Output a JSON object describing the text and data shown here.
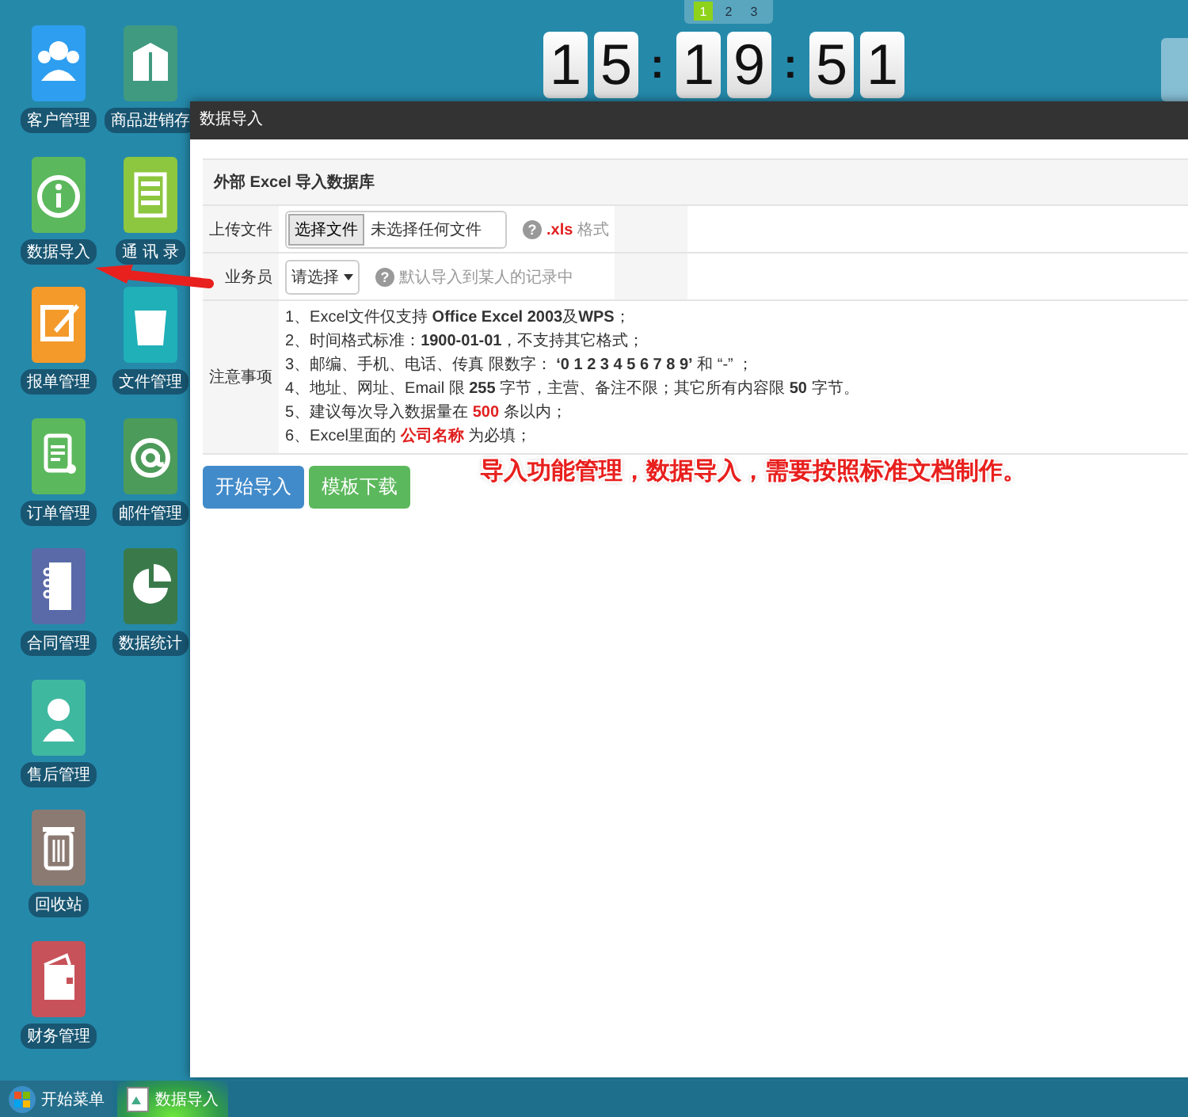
{
  "pager": {
    "pages": [
      {
        "label": "1",
        "selected": true
      },
      {
        "label": "2",
        "selected": false
      },
      {
        "label": "3",
        "selected": false
      }
    ]
  },
  "clock": {
    "parts": [
      {
        "kind": "digit",
        "text": "1"
      },
      {
        "kind": "digit",
        "text": "5"
      },
      {
        "kind": "colon",
        "text": ":"
      },
      {
        "kind": "digit",
        "text": "1"
      },
      {
        "kind": "digit",
        "text": "9"
      },
      {
        "kind": "colon",
        "text": ":"
      },
      {
        "kind": "digit",
        "text": "5"
      },
      {
        "kind": "digit",
        "text": "1"
      }
    ]
  },
  "desktop_icons": {
    "columns": [
      [
        {
          "label": "客户管理",
          "color": "#2e9ef0"
        },
        {
          "label": "数据导入",
          "color": "#5cb85c"
        },
        {
          "label": "报单管理",
          "color": "#f39a2b"
        },
        {
          "label": "订单管理",
          "color": "#5cb85c"
        },
        {
          "label": "合同管理",
          "color": "#5a6aa8"
        },
        {
          "label": "售后管理",
          "color": "#3fb8a0"
        },
        {
          "label": "回收站",
          "color": "#8a7a72"
        },
        {
          "label": "财务管理",
          "color": "#c8525a"
        }
      ],
      [
        {
          "label": "商品进销存",
          "color": "#3f9a80"
        },
        {
          "label": "通 讯 录",
          "color": "#8dc63f"
        },
        {
          "label": "文件管理",
          "color": "#1fb0b8"
        },
        {
          "label": "邮件管理",
          "color": "#4d9b5a"
        },
        {
          "label": "数据统计",
          "color": "#3a7a4a"
        }
      ]
    ]
  },
  "window": {
    "title": "数据导入",
    "form": {
      "heading": "外部 Excel 导入数据库",
      "upload": {
        "label": "上传文件",
        "button": "选择文件",
        "file_status": "未选择任何文件",
        "help_icon": "?",
        "ext": ".xls",
        "ext_text": "格式"
      },
      "staff": {
        "label": "业务员",
        "select": "请选择",
        "help_icon": "?",
        "hint": "默认导入到某人的记录中"
      },
      "notes": {
        "label": "注意事项",
        "items": [
          [
            {
              "kind": "plain",
              "text": "1、Excel文件仅支持 "
            },
            {
              "kind": "bold",
              "text": "Office Excel 2003"
            },
            {
              "kind": "plain",
              "text": "及"
            },
            {
              "kind": "bold",
              "text": "WPS"
            },
            {
              "kind": "plain",
              "text": "；"
            }
          ],
          [
            {
              "kind": "plain",
              "text": "2、时间格式标准："
            },
            {
              "kind": "bold",
              "text": "1900-01-01"
            },
            {
              "kind": "plain",
              "text": "，不支持其它格式；"
            }
          ],
          [
            {
              "kind": "plain",
              "text": "3、邮编、手机、电话、传真 限数字： "
            },
            {
              "kind": "bold",
              "text": "‘0 1 2 3 4 5 6 7 8 9’"
            },
            {
              "kind": "plain",
              "text": " 和 “-” ；"
            }
          ],
          [
            {
              "kind": "plain",
              "text": "4、地址、网址、Email 限 "
            },
            {
              "kind": "bold",
              "text": "255"
            },
            {
              "kind": "plain",
              "text": " 字节，主营、备注不限；其它所有内容限 "
            },
            {
              "kind": "bold",
              "text": "50"
            },
            {
              "kind": "plain",
              "text": " 字节。"
            }
          ],
          [
            {
              "kind": "plain",
              "text": "5、建议每次导入数据量在 "
            },
            {
              "kind": "alert",
              "text": "500"
            },
            {
              "kind": "plain",
              "text": " 条以内；"
            }
          ],
          [
            {
              "kind": "plain",
              "text": "6、Excel里面的 "
            },
            {
              "kind": "alert",
              "text": "公司名称"
            },
            {
              "kind": "plain",
              "text": " 为必填；"
            }
          ]
        ]
      }
    },
    "buttons": [
      {
        "label": "开始导入",
        "kind": "primary"
      },
      {
        "label": "模板下载",
        "kind": "success"
      }
    ]
  },
  "annotation": {
    "caption": "导入功能管理，数据导入，需要按照标准文档制作。"
  },
  "taskbar": {
    "start": "开始菜单",
    "tasks": [
      {
        "label": "数据导入",
        "active": true
      }
    ]
  }
}
